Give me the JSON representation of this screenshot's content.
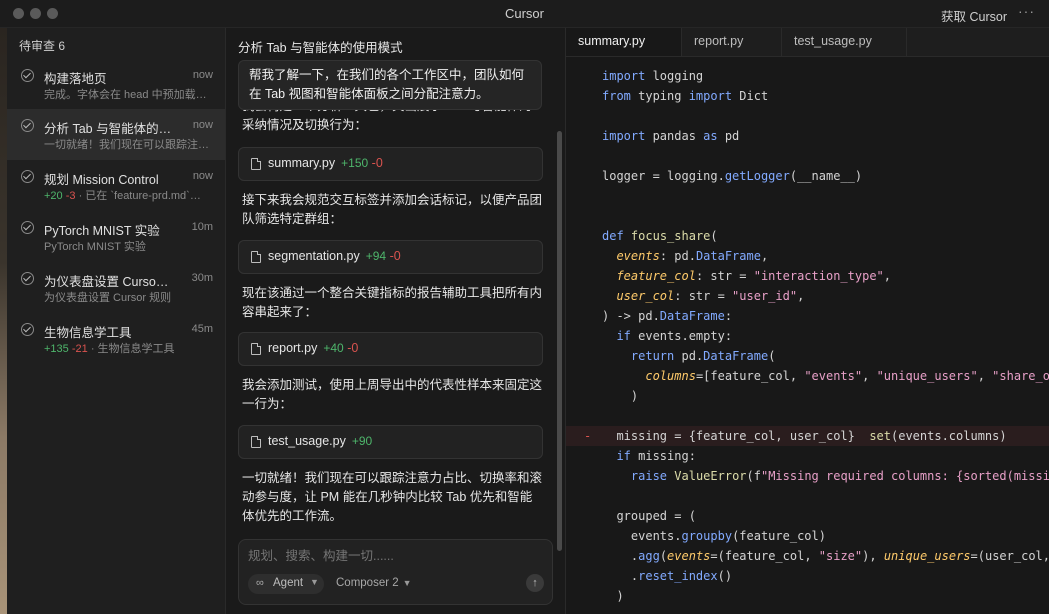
{
  "window": {
    "title": "Cursor",
    "action_label": "获取 Cursor",
    "more_label": "···"
  },
  "sidebar": {
    "header": "待审查 6",
    "items": [
      {
        "title": "构建落地页",
        "time": "now",
        "subtitle": "完成。字体会在 head 中预加载…",
        "added": "",
        "removed": ""
      },
      {
        "title": "分析 Tab 与智能体的使用模式",
        "time": "now",
        "subtitle": "一切就绪！我们现在可以跟踪注意力占比、切换率…",
        "added": "",
        "removed": ""
      },
      {
        "title": "规划 Mission Control",
        "time": "now",
        "subtitle": "· 已在 `feature-prd.md`…",
        "added": "+20",
        "removed": "-3"
      },
      {
        "title": "PyTorch MNIST 实验",
        "time": "10m",
        "subtitle": "PyTorch MNIST 实验",
        "added": "",
        "removed": ""
      },
      {
        "title": "为仪表盘设置 Cursor 规则",
        "time": "30m",
        "subtitle": "为仪表盘设置 Cursor 规则",
        "added": "",
        "removed": ""
      },
      {
        "title": "生物信息学工具",
        "time": "45m",
        "subtitle": "· 生物信息学工具",
        "added": "+135",
        "removed": "-21"
      }
    ]
  },
  "chat": {
    "title": "分析 Tab 与智能体的使用模式",
    "user_message": "帮我了解一下，在我们的各个工作区中，团队如何在 Tab 视图和智能体面板之间分配注意力。",
    "paragraphs": [
      "我会构建一个分析工具包，突出展示 Tab 与智能体的采纳情况及切换行为：",
      "接下来我会规范交互标签并添加会话标记，以便产品团队筛选特定群组：",
      "现在该通过一个整合关键指标的报告辅助工具把所有内容串起来了：",
      "我会添加测试，使用上周导出中的代表性样本来固定这一行为：",
      "一切就绪！我们现在可以跟踪注意力占比、切换率和滚动参与度，让 PM 能在几秒钟内比较 Tab 优先和智能体优先的工作流。"
    ],
    "files": [
      {
        "name": "summary.py",
        "added": "+150",
        "removed": "-0"
      },
      {
        "name": "segmentation.py",
        "added": "+94",
        "removed": "-0"
      },
      {
        "name": "report.py",
        "added": "+40",
        "removed": "-0"
      },
      {
        "name": "test_usage.py",
        "added": "+90",
        "removed": ""
      }
    ],
    "composer": {
      "placeholder": "规划、搜索、构建一切......",
      "mode_icon": "∞",
      "mode": "Agent",
      "model": "Composer 2",
      "send_icon": "↑"
    }
  },
  "editor": {
    "tabs": [
      "summary.py",
      "report.py",
      "test_usage.py"
    ],
    "active_tab": "summary.py",
    "deleted_marker": "-",
    "code_lines": [
      "import logging",
      "from typing import Dict",
      "",
      "import pandas as pd",
      "",
      "logger = logging.getLogger(__name__)",
      "",
      "",
      "def focus_share(",
      "  events: pd.DataFrame,",
      "  feature_col: str = \"interaction_type\",",
      "  user_col: str = \"user_id\",",
      ") -> pd.DataFrame:",
      "  if events.empty:",
      "    return pd.DataFrame(",
      "      columns=[feature_col, \"events\", \"unique_users\", \"share_o",
      "    )",
      "",
      "  missing = {feature_col, user_col}  set(events.columns)",
      "  if missing:",
      "    raise ValueError(f\"Missing required columns: {sorted(missi",
      "",
      "  grouped = (",
      "    events.groupby(feature_col)",
      "    .agg(events=(feature_col, \"size\"), unique_users=(user_col,",
      "    .reset_index()",
      "  )"
    ]
  }
}
